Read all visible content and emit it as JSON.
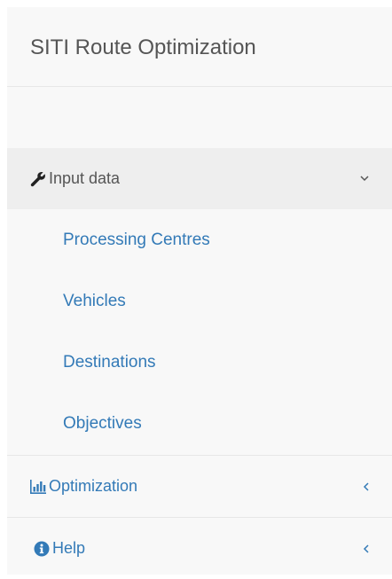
{
  "brand": {
    "title": "SITI Route Optimization"
  },
  "menu": {
    "input_data": {
      "label": "Input data",
      "icon": "wrench-icon",
      "arrow": "chevron-down-icon",
      "expanded": true,
      "children": [
        {
          "label": "Processing Centres"
        },
        {
          "label": "Vehicles"
        },
        {
          "label": "Destinations"
        },
        {
          "label": "Objectives"
        }
      ]
    },
    "optimization": {
      "label": "Optimization",
      "icon": "bar-chart-icon",
      "arrow": "chevron-left-icon"
    },
    "help": {
      "label": "Help",
      "icon": "info-circle-icon",
      "arrow": "chevron-left-icon"
    }
  },
  "colors": {
    "link": "#337ab7",
    "text": "#555555",
    "background": "#f8f8f8",
    "active_background": "#eeeeee",
    "border": "#e7e7e7"
  }
}
